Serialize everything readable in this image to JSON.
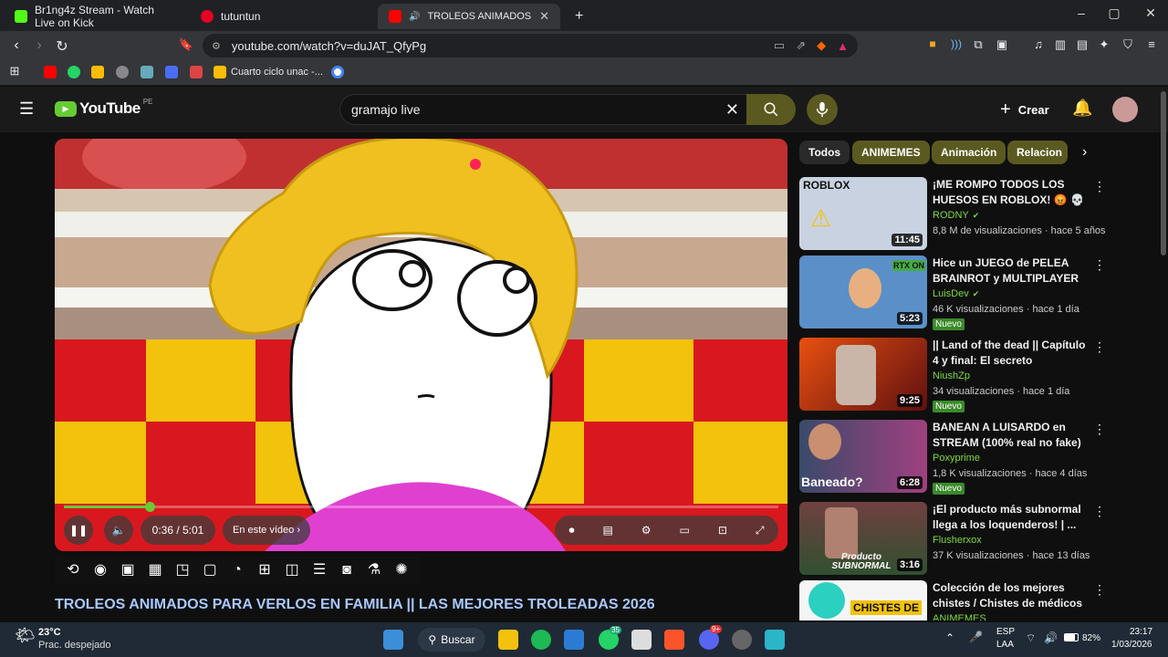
{
  "browser": {
    "tabs": [
      {
        "title": "Br1ng4z Stream - Watch Live on Kick"
      },
      {
        "title": "tutuntun"
      },
      {
        "title": "TROLEOS ANIMADOS PARA V"
      }
    ],
    "url": "youtube.com/watch?v=duJAT_QfyPg",
    "bookmarks": [
      {
        "label": "Cuarto ciclo unac -..."
      }
    ]
  },
  "youtube": {
    "region": "PE",
    "logo_text": "YouTube",
    "search_value": "gramajo live",
    "create_label": "Crear",
    "video_title": "TROLEOS ANIMADOS PARA VERLOS EN FAMILIA || LAS MEJORES TROLEADAS 2026",
    "player": {
      "time": "0:36 / 5:01",
      "chapter_label": "En este vídeo",
      "progress": 0.12
    },
    "chips": [
      {
        "label": "Todos"
      },
      {
        "label": "ANIMEMES"
      },
      {
        "label": "Animación"
      },
      {
        "label": "Relacion"
      }
    ],
    "sidebar_videos": [
      {
        "title": "¡ME ROMPO TODOS LOS HUESOS EN ROBLOX! 😡 💀 | ...",
        "channel": "RODNY",
        "verified": true,
        "meta": "8,8 M de visualizaciones · hace 5 años",
        "duration": "11:45",
        "nuevo": "",
        "thumb_text": "ROBLOX"
      },
      {
        "title": "Hice un JUEGO de PELEA BRAINROT y MULTIPLAYER",
        "channel": "LuisDev",
        "verified": true,
        "meta": "46 K visualizaciones · hace 1 día",
        "duration": "5:23",
        "nuevo": "Nuevo",
        "thumb_text": "RTX ON"
      },
      {
        "title": "|| Land of the dead || Capítulo 4 y final: El secreto",
        "channel": "NiushZp",
        "verified": false,
        "meta": "34 visualizaciones · hace 1 día",
        "duration": "9:25",
        "nuevo": "Nuevo",
        "thumb_text": ""
      },
      {
        "title": "BANEAN A LUISARDO en STREAM (100% real no fake)",
        "channel": "Poxyprime",
        "verified": false,
        "meta": "1,8 K visualizaciones · hace 4 días",
        "duration": "6:28",
        "nuevo": "Nuevo",
        "thumb_text": "Baneado?"
      },
      {
        "title": "¡El producto más subnormal llega a los loquenderos! | ...",
        "channel": "Flusherxox",
        "verified": false,
        "meta": "37 K visualizaciones · hace 13 días",
        "duration": "3:16",
        "nuevo": "",
        "thumb_text": "Producto SUBNORMAL"
      },
      {
        "title": "Colección de los mejores chistes / Chistes de médicos /...",
        "channel": "ANIMEMES",
        "verified": false,
        "meta": "",
        "duration": "",
        "nuevo": "",
        "thumb_text": "CHISTES DE"
      }
    ]
  },
  "taskbar": {
    "weather_temp": "23°C",
    "weather_desc": "Prac. despejado",
    "search_label": "Buscar",
    "lang1": "ESP",
    "lang2": "LAA",
    "battery": "82%",
    "time": "23:17",
    "date": "1/03/2026",
    "badge_whatsapp": "35",
    "badge_discord": "9+"
  },
  "colors": {
    "accent_olive": "#5a5a20",
    "title_blue": "#a8c8ff",
    "green": "#7cdc3a"
  }
}
